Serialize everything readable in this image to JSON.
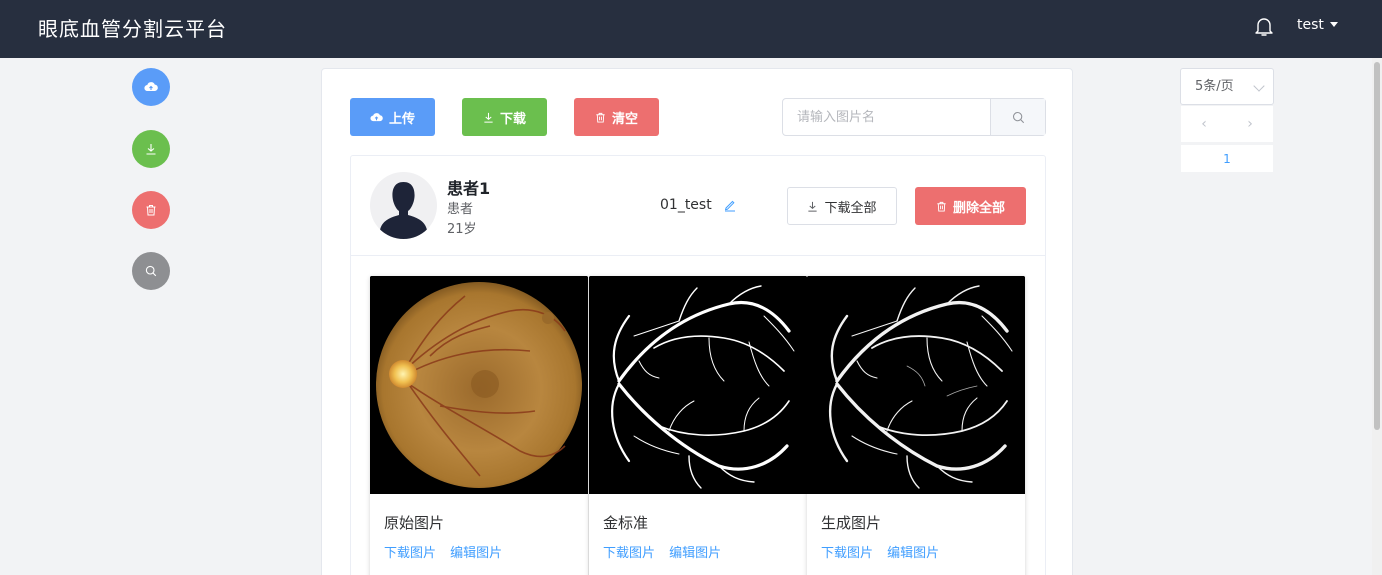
{
  "app": {
    "title": "眼底血管分割云平台",
    "user": "test"
  },
  "side_buttons": [
    {
      "icon": "cloud-upload-icon"
    },
    {
      "icon": "download-icon"
    },
    {
      "icon": "trash-icon"
    },
    {
      "icon": "search-icon"
    }
  ],
  "toolbar": {
    "upload_label": "上传",
    "download_label": "下载",
    "clear_label": "清空"
  },
  "search": {
    "placeholder": "请输入图片名"
  },
  "patient": {
    "name": "患者1",
    "role": "患者",
    "age": "21岁",
    "record": "01_test",
    "download_all_label": "下载全部",
    "delete_all_label": "删除全部"
  },
  "images": [
    {
      "title": "原始图片",
      "download_label": "下载图片",
      "edit_label": "编辑图片"
    },
    {
      "title": "金标准",
      "download_label": "下载图片",
      "edit_label": "编辑图片"
    },
    {
      "title": "生成图片",
      "download_label": "下载图片",
      "edit_label": "编辑图片"
    }
  ],
  "pagination": {
    "page_size": "5条/页",
    "current_page": "1",
    "prev": "‹",
    "next": "›"
  },
  "colors": {
    "header": "#272f3f",
    "primary": "#5a9cf8",
    "success": "#6bbf4e",
    "danger": "#ed6f6f",
    "info": "#8e8f92",
    "link": "#409eff"
  }
}
